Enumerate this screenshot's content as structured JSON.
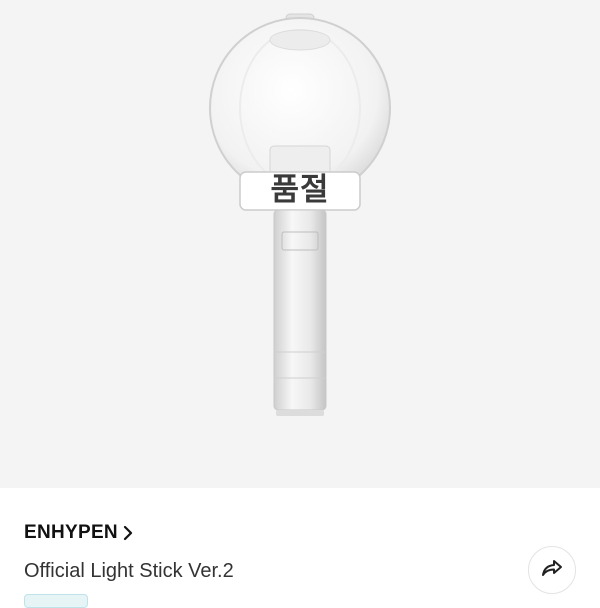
{
  "product": {
    "image_overlay_label": "품절",
    "brand": "ENHYPEN",
    "title": "Official Light Stick Ver.2",
    "badge_text": ""
  },
  "icons": {
    "brand_chevron": "chevron-right-icon",
    "share": "share-icon"
  },
  "colors": {
    "image_background": "#f4f4f4",
    "badge_background": "#e6f4f6"
  }
}
